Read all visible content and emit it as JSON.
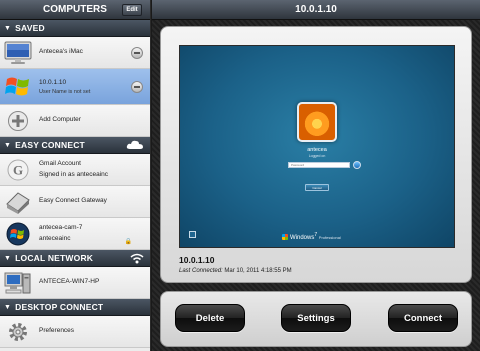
{
  "left": {
    "title": "COMPUTERS",
    "edit_label": "Edit",
    "sections": {
      "saved": "SAVED",
      "easy_connect": "EASY CONNECT",
      "local_network": "LOCAL NETWORK",
      "desktop_connect": "DESKTOP CONNECT"
    },
    "saved_items": [
      {
        "label": "Antecea's iMac",
        "icon": "imac-icon"
      },
      {
        "label": "10.0.1.10",
        "sub": "User Name is not set",
        "icon": "windows-logo-icon",
        "selected": true
      },
      {
        "label": "Add Computer",
        "icon": "add-icon"
      }
    ],
    "easy_items": [
      {
        "label": "Gmail Account",
        "sub": "Signed in as anteceainc",
        "icon": "google-icon"
      },
      {
        "label": "Easy Connect Gateway",
        "icon": "gateway-icon"
      },
      {
        "label": "antecea-cam-7",
        "sub": "anteceainc",
        "icon": "windows7-icon"
      }
    ],
    "local_items": [
      {
        "label": "ANTECEA-WIN7-HP",
        "icon": "pc-tower-icon"
      }
    ],
    "desktop_items": [
      {
        "label": "Preferences",
        "icon": "gear-icon"
      }
    ]
  },
  "right": {
    "title": "10.0.1.10",
    "screen": {
      "user": "antecea",
      "sub": "Logged on",
      "password_placeholder": "Password",
      "cancel": "Cancel",
      "brand": "Windows",
      "version": "7",
      "edition": "Professional"
    },
    "detail_title": "10.0.1.10",
    "last_connected_label": "Last Connected:",
    "last_connected_value": "Mar 10, 2011 4:18:55 PM",
    "buttons": {
      "delete": "Delete",
      "settings": "Settings",
      "connect": "Connect"
    }
  },
  "colors": {
    "selected_row": "#8fb4e6",
    "header_dark": "#2f353d",
    "desktop_blue": "#1b6188"
  }
}
